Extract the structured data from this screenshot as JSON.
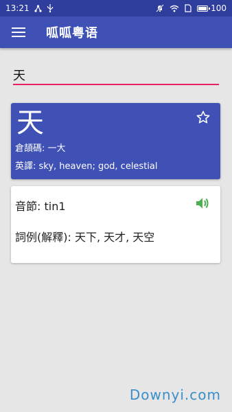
{
  "status_bar": {
    "time": "13:21",
    "battery_level": "100"
  },
  "app_bar": {
    "title": "呱呱粤语"
  },
  "search": {
    "value": "天",
    "placeholder": ""
  },
  "word_card": {
    "character": "天",
    "cangjie": "倉頡碼: 一大",
    "english": "英譯: sky, heaven; god, celestial"
  },
  "detail_card": {
    "pronunciation": "音節: tin1",
    "examples": "詞例(解釋): 天下, 天才, 天空"
  },
  "watermark": {
    "text": "Downyi.com"
  },
  "colors": {
    "primary": "#3f51b5",
    "status_bar": "#2f3d9c",
    "accent": "#e91e63",
    "speaker": "#4caf50"
  },
  "battery_fraction": 1.0
}
